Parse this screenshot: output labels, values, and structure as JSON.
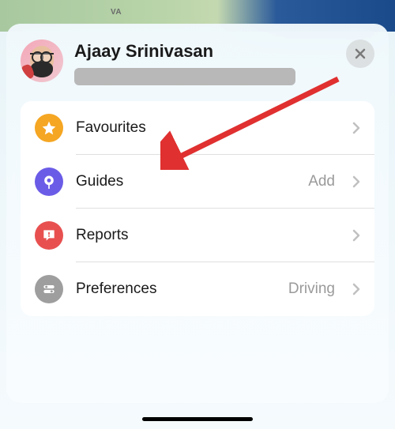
{
  "map": {
    "visible_label": "VA"
  },
  "header": {
    "username": "Ajaay Srinivasan"
  },
  "menu": {
    "items": [
      {
        "label": "Favourites",
        "trailing": "",
        "icon": "star-icon",
        "color": "#f5a623"
      },
      {
        "label": "Guides",
        "trailing": "Add",
        "icon": "pin-icon",
        "color": "#6b5ce7"
      },
      {
        "label": "Reports",
        "trailing": "",
        "icon": "alert-icon",
        "color": "#e85050"
      },
      {
        "label": "Preferences",
        "trailing": "Driving",
        "icon": "toggle-icon",
        "color": "#9e9e9e"
      }
    ]
  },
  "annotation": {
    "arrow_target": "favourites-row"
  }
}
